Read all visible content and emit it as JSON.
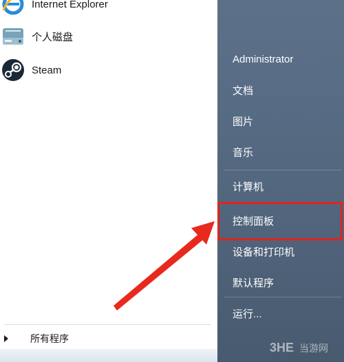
{
  "left": {
    "programs": [
      {
        "label": "Internet Explorer",
        "icon": "internet-explorer-icon"
      },
      {
        "label": "个人磁盘",
        "icon": "disk-icon"
      },
      {
        "label": "Steam",
        "icon": "steam-icon"
      }
    ],
    "all_programs": "所有程序"
  },
  "right": {
    "items": [
      {
        "label": "Administrator"
      },
      {
        "label": "文档"
      },
      {
        "label": "图片"
      },
      {
        "label": "音乐"
      },
      {
        "label": "计算机"
      },
      {
        "label": "控制面板"
      },
      {
        "label": "设备和打印机"
      },
      {
        "label": "默认程序"
      },
      {
        "label": "运行..."
      }
    ]
  },
  "watermark": {
    "logo": "3HE",
    "text": "当游网"
  },
  "colors": {
    "highlight": "#e0241b",
    "panel": "#566b83",
    "arrow": "#e8291d"
  }
}
